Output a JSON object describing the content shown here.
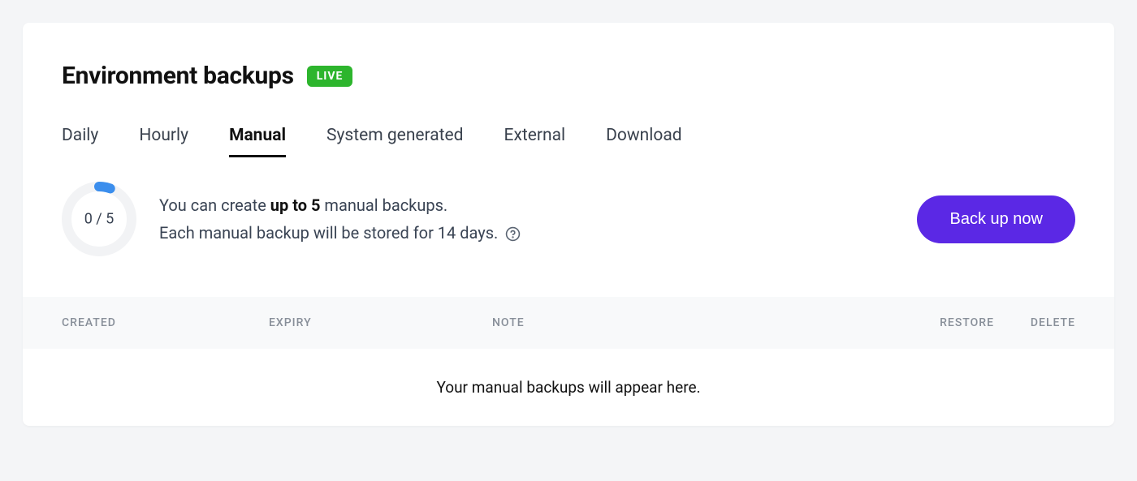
{
  "header": {
    "title": "Environment backups",
    "badge": "LIVE"
  },
  "tabs": [
    {
      "label": "Daily",
      "active": false
    },
    {
      "label": "Hourly",
      "active": false
    },
    {
      "label": "Manual",
      "active": true
    },
    {
      "label": "System generated",
      "active": false
    },
    {
      "label": "External",
      "active": false
    },
    {
      "label": "Download",
      "active": false
    }
  ],
  "gauge": {
    "used": 0,
    "total": 5,
    "display": "0 / 5"
  },
  "info": {
    "line1_prefix": "You can create ",
    "line1_bold": "up to 5",
    "line1_suffix": " manual backups.",
    "line2": "Each manual backup will be stored for 14 days."
  },
  "actions": {
    "backup_now": "Back up now"
  },
  "table": {
    "columns": {
      "created": "CREATED",
      "expiry": "EXPIRY",
      "note": "NOTE",
      "restore": "RESTORE",
      "delete": "DELETE"
    },
    "empty_message": "Your manual backups will appear here."
  }
}
